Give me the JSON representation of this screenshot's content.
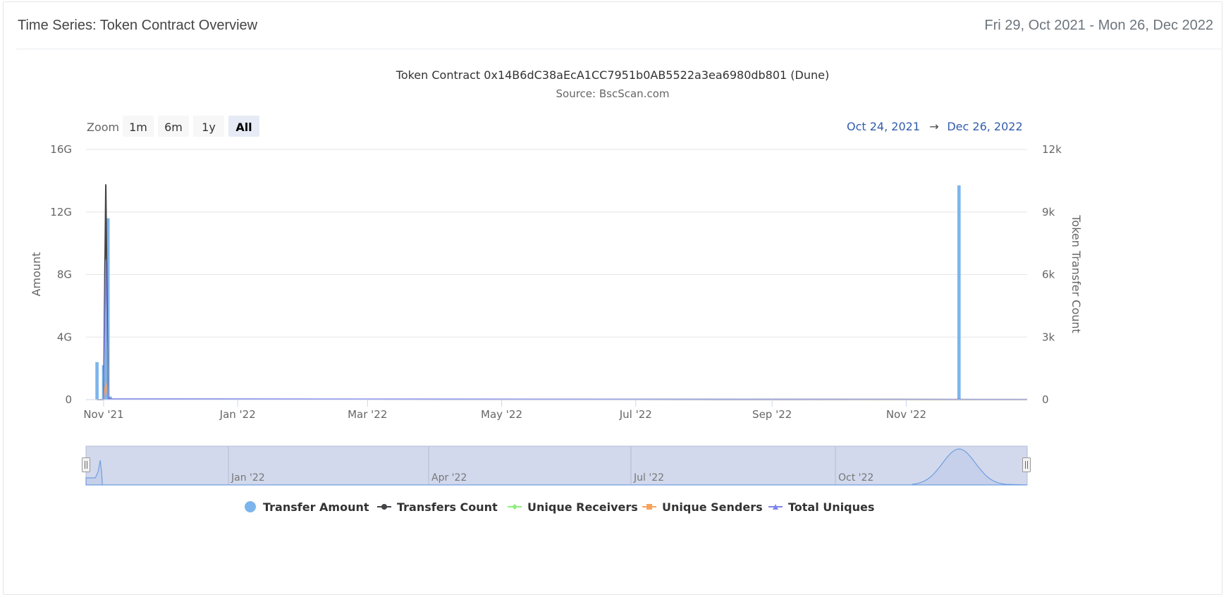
{
  "header": {
    "title": "Time Series: Token Contract Overview",
    "date_range": "Fri 29, Oct 2021 - Mon 26, Dec 2022"
  },
  "range_selector": {
    "zoom_label": "Zoom",
    "buttons": [
      "1m",
      "6m",
      "1y",
      "All"
    ],
    "selected": "All",
    "from": "Oct 24, 2021",
    "arrow": "→",
    "to": "Dec 26, 2022"
  },
  "navigator": {
    "labels": [
      "Jan '22",
      "Apr '22",
      "Jul '22",
      "Oct '22"
    ]
  },
  "chart_data": {
    "type": "bar",
    "title": "Token Contract 0x14B6dC38aEcA1CC7951b0AB5522a3ea6980db801 (Dune)",
    "subtitle": "Source: BscScan.com",
    "x_axis": {
      "type": "date",
      "range": [
        "2021-10-24",
        "2022-12-26"
      ],
      "tick_labels": [
        "Nov '21",
        "Jan '22",
        "Mar '22",
        "May '22",
        "Jul '22",
        "Sep '22",
        "Nov '22"
      ],
      "tick_dates": [
        "2021-11-01",
        "2022-01-01",
        "2022-03-01",
        "2022-05-01",
        "2022-07-01",
        "2022-09-01",
        "2022-11-01"
      ]
    },
    "y_axis_left": {
      "title": "Amount",
      "min": 0,
      "max": 16000000000,
      "ticks": [
        "0",
        "4G",
        "8G",
        "12G",
        "16G"
      ]
    },
    "y_axis_right": {
      "title": "Token Transfer Count",
      "min": 0,
      "max": 12000,
      "ticks": [
        "0",
        "3k",
        "6k",
        "9k",
        "12k"
      ]
    },
    "grid": true,
    "legend_position": "bottom",
    "series": [
      {
        "name": "Transfer Amount",
        "kind": "column",
        "axis": "left",
        "color": "#7cb5ec",
        "marker": "circle",
        "points": [
          {
            "x": "2021-10-29",
            "y": 2400000000
          },
          {
            "x": "2021-11-01",
            "y": 2200000000
          },
          {
            "x": "2021-11-02",
            "y": 9000000000
          },
          {
            "x": "2021-11-03",
            "y": 11600000000
          },
          {
            "x": "2021-11-04",
            "y": 200000000
          },
          {
            "x": "2022-11-25",
            "y": 13700000000
          }
        ]
      },
      {
        "name": "Transfers Count",
        "kind": "line",
        "axis": "right",
        "color": "#434348",
        "marker": "circle",
        "points": [
          {
            "x": "2021-10-29",
            "y": 0
          },
          {
            "x": "2021-11-01",
            "y": 0
          },
          {
            "x": "2021-11-02",
            "y": 10300
          },
          {
            "x": "2021-11-03",
            "y": 60
          },
          {
            "x": "2021-11-05",
            "y": 20
          },
          {
            "x": "2022-12-26",
            "y": 5
          }
        ]
      },
      {
        "name": "Unique Receivers",
        "kind": "line",
        "axis": "right",
        "color": "#90ed7d",
        "marker": "diamond",
        "points": [
          {
            "x": "2021-10-29",
            "y": 0
          },
          {
            "x": "2021-11-01",
            "y": 0
          },
          {
            "x": "2021-11-02",
            "y": 5500
          },
          {
            "x": "2021-11-03",
            "y": 30
          },
          {
            "x": "2022-12-26",
            "y": 2
          }
        ]
      },
      {
        "name": "Unique Senders",
        "kind": "line",
        "axis": "right",
        "color": "#f7a35c",
        "marker": "square",
        "points": [
          {
            "x": "2021-10-29",
            "y": 0
          },
          {
            "x": "2021-11-01",
            "y": 0
          },
          {
            "x": "2021-11-02",
            "y": 800
          },
          {
            "x": "2021-11-03",
            "y": 20
          },
          {
            "x": "2022-12-26",
            "y": 2
          }
        ]
      },
      {
        "name": "Total Uniques",
        "kind": "line",
        "axis": "right",
        "color": "#8085e9",
        "marker": "triangle",
        "points": [
          {
            "x": "2021-10-29",
            "y": 0
          },
          {
            "x": "2021-11-01",
            "y": 0
          },
          {
            "x": "2021-11-02",
            "y": 6700
          },
          {
            "x": "2021-11-03",
            "y": 40
          },
          {
            "x": "2022-12-26",
            "y": 3
          }
        ]
      }
    ]
  }
}
